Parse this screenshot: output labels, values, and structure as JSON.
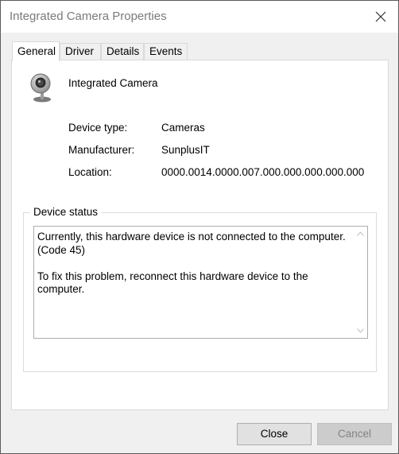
{
  "window": {
    "title": "Integrated Camera Properties"
  },
  "tabs": [
    {
      "label": "General",
      "active": true
    },
    {
      "label": "Driver",
      "active": false
    },
    {
      "label": "Details",
      "active": false
    },
    {
      "label": "Events",
      "active": false
    }
  ],
  "device": {
    "icon": "webcam-icon",
    "name": "Integrated Camera",
    "properties": [
      {
        "label": "Device type:",
        "value": "Cameras"
      },
      {
        "label": "Manufacturer:",
        "value": "SunplusIT"
      },
      {
        "label": "Location:",
        "value": "0000.0014.0000.007.000.000.000.000.000"
      }
    ]
  },
  "status": {
    "legend": "Device status",
    "text": "Currently, this hardware device is not connected to the computer. (Code 45)\n\nTo fix this problem, reconnect this hardware device to the computer."
  },
  "buttons": {
    "close_label": "Close",
    "cancel_label": "Cancel"
  }
}
